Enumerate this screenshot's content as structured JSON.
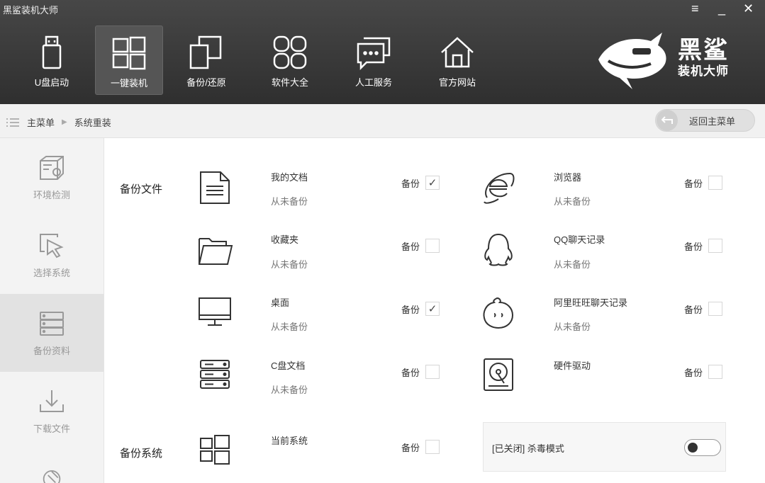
{
  "app": {
    "title": "黑鲨装机大师"
  },
  "window": {
    "menu": "≡",
    "minimize": "_",
    "close": "✕"
  },
  "nav": [
    {
      "label": "U盘启动",
      "icon": "usb-drive-icon"
    },
    {
      "label": "一键装机",
      "icon": "windows-icon",
      "active": true
    },
    {
      "label": "备份/还原",
      "icon": "backup-restore-icon"
    },
    {
      "label": "软件大全",
      "icon": "apps-grid-icon"
    },
    {
      "label": "人工服务",
      "icon": "chat-icon"
    },
    {
      "label": "官方网站",
      "icon": "home-icon"
    }
  ],
  "brand": {
    "line1": "黑鲨",
    "line2": "装机大师"
  },
  "breadcrumb": {
    "home": "主菜单",
    "current": "系统重装"
  },
  "back_button": "返回主菜单",
  "sidebar": [
    {
      "label": "环境检测",
      "icon": "environment-check-icon"
    },
    {
      "label": "选择系统",
      "icon": "cursor-select-icon"
    },
    {
      "label": "备份资料",
      "icon": "server-stack-icon",
      "active": true
    },
    {
      "label": "下载文件",
      "icon": "download-icon"
    },
    {
      "label": "",
      "icon": "install-icon"
    }
  ],
  "backup_files": {
    "section_label": "备份文件",
    "backup_label": "备份",
    "left": [
      {
        "name": "我的文档",
        "status": "从未备份",
        "checked": true,
        "icon": "document-icon"
      },
      {
        "name": "收藏夹",
        "status": "从未备份",
        "checked": false,
        "icon": "folder-icon"
      },
      {
        "name": "桌面",
        "status": "从未备份",
        "checked": true,
        "icon": "monitor-icon"
      },
      {
        "name": "C盘文档",
        "status": "从未备份",
        "checked": false,
        "icon": "drive-stack-icon"
      }
    ],
    "right": [
      {
        "name": "浏览器",
        "status": "从未备份",
        "checked": false,
        "icon": "ie-browser-icon"
      },
      {
        "name": "QQ聊天记录",
        "status": "从未备份",
        "checked": false,
        "icon": "qq-penguin-icon"
      },
      {
        "name": "阿里旺旺聊天记录",
        "status": "从未备份",
        "checked": false,
        "icon": "aliwangwang-icon"
      },
      {
        "name": "硬件驱动",
        "status": "",
        "checked": false,
        "icon": "hard-disk-icon"
      }
    ]
  },
  "backup_system": {
    "section_label": "备份系统",
    "name": "当前系统",
    "backup_label": "备份",
    "checked": false,
    "icon": "windows-icon"
  },
  "antivirus": {
    "label": "[已关闭] 杀毒模式",
    "enabled": false
  },
  "check_mark": "✓"
}
